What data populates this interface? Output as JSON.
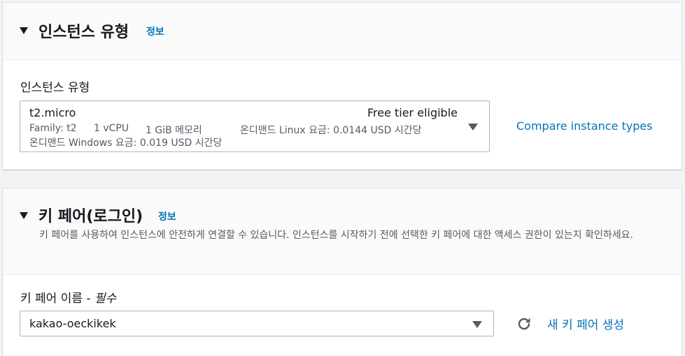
{
  "instance_type_section": {
    "title": "인스턴스 유형",
    "info_link": "정보",
    "field_label": "인스턴스 유형",
    "selected": {
      "name": "t2.micro",
      "tier": "Free tier eligible",
      "family": "Family: t2",
      "vcpu": "1 vCPU",
      "memory": "1 GiB 메모리",
      "linux_price": "온디맨드 Linux 요금: 0.0144 USD 시간당",
      "windows_price": "온디맨드 Windows 요금: 0.019 USD 시간당"
    },
    "compare_link": "Compare instance types"
  },
  "key_pair_section": {
    "title": "키 페어(로그인)",
    "info_link": "정보",
    "description": "키 페어를 사용하여 인스턴스에 안전하게 연결할 수 있습니다. 인스턴스를 시작하기 전에 선택한 키 페어에 대한 액세스 권한이 있는지 확인하세요.",
    "field_label": "키 페어 이름",
    "field_label_suffix": " - 필수",
    "selected_value": "kakao-oeckikek",
    "create_link": "새 키 페어 생성"
  },
  "icons": {
    "collapse": "caret-down-icon",
    "dropdown": "caret-down-icon",
    "refresh": "refresh-icon"
  },
  "colors": {
    "link": "#0073bb",
    "text": "#16191f",
    "muted": "#545b64",
    "background": "#f2f3f3"
  }
}
